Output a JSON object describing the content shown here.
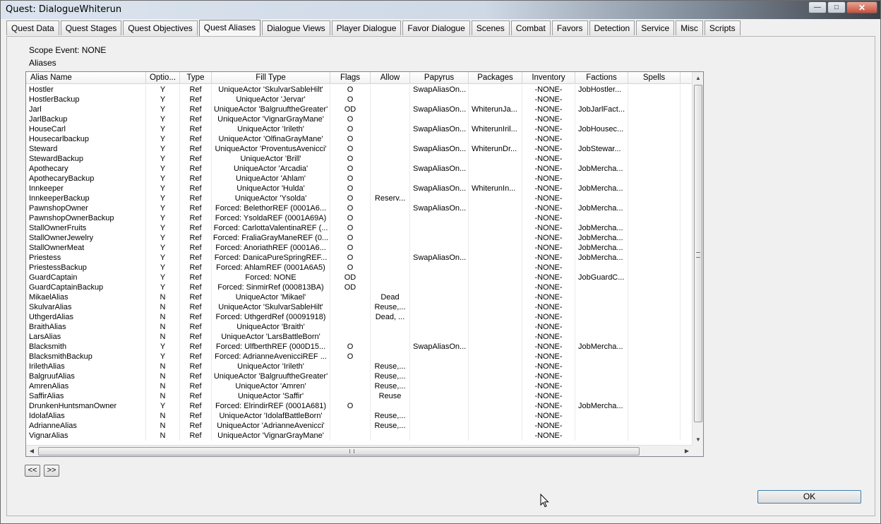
{
  "window": {
    "title": "Quest: DialogueWhiterun",
    "minimize": "—",
    "maximize": "□",
    "close": "✕"
  },
  "tabs": [
    "Quest Data",
    "Quest Stages",
    "Quest Objectives",
    "Quest Aliases",
    "Dialogue Views",
    "Player Dialogue",
    "Favor Dialogue",
    "Scenes",
    "Combat",
    "Favors",
    "Detection",
    "Service",
    "Misc",
    "Scripts"
  ],
  "active_tab": "Quest Aliases",
  "scope_event": "Scope Event: NONE",
  "aliases_label": "Aliases",
  "columns": [
    "Alias Name",
    "Optio...",
    "Type",
    "Fill Type",
    "Flags",
    "Allow",
    "Papyrus",
    "Packages",
    "Inventory",
    "Factions",
    "Spells"
  ],
  "rows": [
    [
      "Hostler",
      "Y",
      "Ref",
      "UniqueActor 'SkulvarSableHilt'",
      "O",
      "",
      "SwapAliasOn...",
      "",
      "-NONE-",
      "JobHostler...",
      ""
    ],
    [
      "HostlerBackup",
      "Y",
      "Ref",
      "UniqueActor 'Jervar'",
      "O",
      "",
      "",
      "",
      "-NONE-",
      "",
      ""
    ],
    [
      "Jarl",
      "Y",
      "Ref",
      "UniqueActor 'BalgruuftheGreater'",
      "OD",
      "",
      "SwapAliasOn...",
      "WhiterunJa...",
      "-NONE-",
      "JobJarlFact...",
      ""
    ],
    [
      "JarlBackup",
      "Y",
      "Ref",
      "UniqueActor 'VignarGrayMane'",
      "O",
      "",
      "",
      "",
      "-NONE-",
      "",
      ""
    ],
    [
      "HouseCarl",
      "Y",
      "Ref",
      "UniqueActor 'Irileth'",
      "O",
      "",
      "SwapAliasOn...",
      "WhiterunIril...",
      "-NONE-",
      "JobHousec...",
      ""
    ],
    [
      "Housecarlbackup",
      "Y",
      "Ref",
      "UniqueActor 'OlfinaGrayMane'",
      "O",
      "",
      "",
      "",
      "-NONE-",
      "",
      ""
    ],
    [
      "Steward",
      "Y",
      "Ref",
      "UniqueActor 'ProventusAvenicci'",
      "O",
      "",
      "SwapAliasOn...",
      "WhiterunDr...",
      "-NONE-",
      "JobStewar...",
      ""
    ],
    [
      "StewardBackup",
      "Y",
      "Ref",
      "UniqueActor 'Brill'",
      "O",
      "",
      "",
      "",
      "-NONE-",
      "",
      ""
    ],
    [
      "Apothecary",
      "Y",
      "Ref",
      "UniqueActor 'Arcadia'",
      "O",
      "",
      "SwapAliasOn...",
      "",
      "-NONE-",
      "JobMercha...",
      ""
    ],
    [
      "ApothecaryBackup",
      "Y",
      "Ref",
      "UniqueActor 'Ahlam'",
      "O",
      "",
      "",
      "",
      "-NONE-",
      "",
      ""
    ],
    [
      "Innkeeper",
      "Y",
      "Ref",
      "UniqueActor 'Hulda'",
      "O",
      "",
      "SwapAliasOn...",
      "WhiterunIn...",
      "-NONE-",
      "JobMercha...",
      ""
    ],
    [
      "InnkeeperBackup",
      "Y",
      "Ref",
      "UniqueActor 'Ysolda'",
      "O",
      "Reserv...",
      "",
      "",
      "-NONE-",
      "",
      ""
    ],
    [
      "PawnshopOwner",
      "Y",
      "Ref",
      "Forced: BelethorREF (0001A6...",
      "O",
      "",
      "SwapAliasOn...",
      "",
      "-NONE-",
      "JobMercha...",
      ""
    ],
    [
      "PawnshopOwnerBackup",
      "Y",
      "Ref",
      "Forced: YsoldaREF (0001A69A)",
      "O",
      "",
      "",
      "",
      "-NONE-",
      "",
      ""
    ],
    [
      "StallOwnerFruits",
      "Y",
      "Ref",
      "Forced: CarlottaValentinaREF (...",
      "O",
      "",
      "",
      "",
      "-NONE-",
      "JobMercha...",
      ""
    ],
    [
      "StallOwnerJewelry",
      "Y",
      "Ref",
      "Forced: FraliaGrayManeREF (0...",
      "O",
      "",
      "",
      "",
      "-NONE-",
      "JobMercha...",
      ""
    ],
    [
      "StallOwnerMeat",
      "Y",
      "Ref",
      "Forced: AnoriathREF (0001A6...",
      "O",
      "",
      "",
      "",
      "-NONE-",
      "JobMercha...",
      ""
    ],
    [
      "Priestess",
      "Y",
      "Ref",
      "Forced: DanicaPureSpringREF...",
      "O",
      "",
      "SwapAliasOn...",
      "",
      "-NONE-",
      "JobMercha...",
      ""
    ],
    [
      "PriestessBackup",
      "Y",
      "Ref",
      "Forced: AhlamREF (0001A6A5)",
      "O",
      "",
      "",
      "",
      "-NONE-",
      "",
      ""
    ],
    [
      "GuardCaptain",
      "Y",
      "Ref",
      "Forced: NONE",
      "OD",
      "",
      "",
      "",
      "-NONE-",
      "JobGuardC...",
      ""
    ],
    [
      "GuardCaptainBackup",
      "Y",
      "Ref",
      "Forced: SinmirRef (000813BA)",
      "OD",
      "",
      "",
      "",
      "-NONE-",
      "",
      ""
    ],
    [
      "MikaelAlias",
      "N",
      "Ref",
      "UniqueActor 'Mikael'",
      "",
      "Dead",
      "",
      "",
      "-NONE-",
      "",
      ""
    ],
    [
      "SkulvarAlias",
      "N",
      "Ref",
      "UniqueActor 'SkulvarSableHilt'",
      "",
      "Reuse,...",
      "",
      "",
      "-NONE-",
      "",
      ""
    ],
    [
      "UthgerdAlias",
      "N",
      "Ref",
      "Forced: UthgerdRef (00091918)",
      "",
      "Dead, ...",
      "",
      "",
      "-NONE-",
      "",
      ""
    ],
    [
      "BraithAlias",
      "N",
      "Ref",
      "UniqueActor 'Braith'",
      "",
      "",
      "",
      "",
      "-NONE-",
      "",
      ""
    ],
    [
      "LarsAlias",
      "N",
      "Ref",
      "UniqueActor 'LarsBattleBorn'",
      "",
      "",
      "",
      "",
      "-NONE-",
      "",
      ""
    ],
    [
      "Blacksmith",
      "Y",
      "Ref",
      "Forced: UlfberthREF (000D15...",
      "O",
      "",
      "SwapAliasOn...",
      "",
      "-NONE-",
      "JobMercha...",
      ""
    ],
    [
      "BlacksmithBackup",
      "Y",
      "Ref",
      "Forced: AdrianneAvenicciREF ...",
      "O",
      "",
      "",
      "",
      "-NONE-",
      "",
      ""
    ],
    [
      "IrilethAlias",
      "N",
      "Ref",
      "UniqueActor 'Irileth'",
      "",
      "Reuse,...",
      "",
      "",
      "-NONE-",
      "",
      ""
    ],
    [
      "BalgruufAlias",
      "N",
      "Ref",
      "UniqueActor 'BalgruuftheGreater'",
      "",
      "Reuse,...",
      "",
      "",
      "-NONE-",
      "",
      ""
    ],
    [
      "AmrenAlias",
      "N",
      "Ref",
      "UniqueActor 'Amren'",
      "",
      "Reuse,...",
      "",
      "",
      "-NONE-",
      "",
      ""
    ],
    [
      "SaffirAlias",
      "N",
      "Ref",
      "UniqueActor 'Saffir'",
      "",
      "Reuse",
      "",
      "",
      "-NONE-",
      "",
      ""
    ],
    [
      "DrunkenHuntsmanOwner",
      "Y",
      "Ref",
      "Forced: ElrindirREF (0001A681)",
      "O",
      "",
      "",
      "",
      "-NONE-",
      "JobMercha...",
      ""
    ],
    [
      "IdolafAlias",
      "N",
      "Ref",
      "UniqueActor 'IdolafBattleBorn'",
      "",
      "Reuse,...",
      "",
      "",
      "-NONE-",
      "",
      ""
    ],
    [
      "AdrianneAlias",
      "N",
      "Ref",
      "UniqueActor 'AdrianneAvenicci'",
      "",
      "Reuse,...",
      "",
      "",
      "-NONE-",
      "",
      ""
    ],
    [
      "VignarAlias",
      "N",
      "Ref",
      "UniqueActor 'VignarGrayMane'",
      "",
      "",
      "",
      "",
      "-NONE-",
      "",
      ""
    ]
  ],
  "nav": {
    "prev": "<<",
    "next": ">>"
  },
  "ok_label": "OK"
}
